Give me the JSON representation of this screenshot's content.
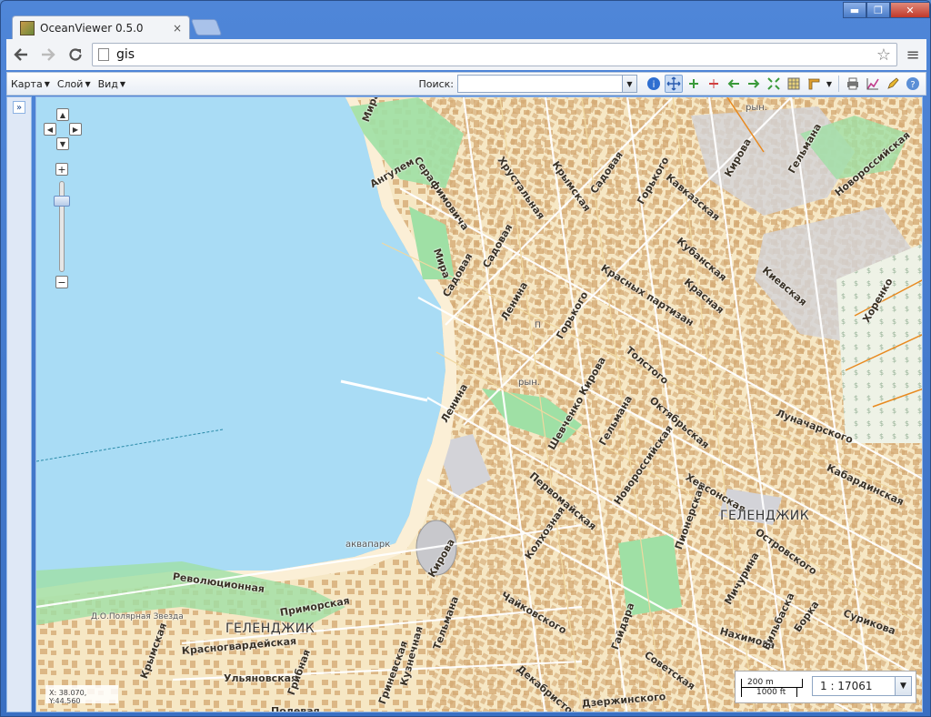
{
  "browser": {
    "tab_title": "OceanViewer 0.5.0",
    "tab_close": "×",
    "url": "gis",
    "window_minimize": "▬",
    "window_maximize": "❐",
    "window_close": "✕"
  },
  "toolbar": {
    "menus": [
      {
        "label": "Карта"
      },
      {
        "label": "Слой"
      },
      {
        "label": "Вид"
      }
    ],
    "search_label": "Поиск:",
    "search_value": ""
  },
  "icons": {
    "back": "back-arrow-icon",
    "forward": "forward-arrow-icon",
    "reload": "reload-icon",
    "star": "bookmark-star-icon",
    "menu": "hamburger-menu-icon"
  },
  "colors": {
    "water": "#a9dcf5",
    "land": "#f6e7c4",
    "park": "#9fe0a5",
    "building": "#d7ae7a",
    "industrial": "#d3d3d8"
  },
  "map": {
    "labels": {
      "street_mira_1": "Мира",
      "street_angulem": "Ангулем",
      "street_serafimovicha": "Серафимовича",
      "street_khrustalnaya": "Хрустальная",
      "street_krymskaya_1": "Крымская",
      "street_sadovaya_1": "Садовая",
      "street_gorkogo_1": "Горького",
      "street_kavkazskaya": "Кавказская",
      "street_kirova_1": "Кирова",
      "street_gelmana_1": "Гельмана",
      "street_novorossiyskaya_1": "Новороссийская",
      "street_mira_2": "Мира",
      "street_sadovaya_2": "Садовая",
      "street_sadovaya_3": "Садовая",
      "street_lenina_1": "Ленина",
      "street_gorkogo_2": "Горького",
      "street_krasnykh_partizan": "Красных партизан",
      "street_krasnaya": "Красная",
      "street_kubanskaya": "Кубанская",
      "street_kievskaya": "Киевская",
      "street_khorenko": "Хоренко",
      "street_tolstogo": "Толстого",
      "street_kirova_2": "Кирова",
      "street_oktyabrskaya": "Октябрьская",
      "street_lunacharskogo": "Луначарского",
      "street_lenina_2": "Ленина",
      "street_shevchenko": "Шевченко",
      "street_gelmana_2": "Гельмана",
      "street_pervomayskaya": "Первомайская",
      "street_novorossiyskaya_2": "Новороссийская",
      "street_khersonskaya": "Херсонская",
      "street_kabardinskaya": "Кабардинская",
      "street_pionerskaya": "Пионерская",
      "street_ostrovskogo": "Островского",
      "street_kolkhoznaya": "Колхозная",
      "street_kirova_3": "Кирова",
      "street_revolyutsionnaya": "Революционная",
      "street_primorskaya": "Приморская",
      "street_krasnogvardeyskaya": "Красногвардейская",
      "street_krymskaya_2": "Крымская",
      "street_gribnaya": "Грибная",
      "street_ulyanovskaya": "Ульяновская",
      "street_kuzhayalova": "Кузнечная",
      "street_tel_mana": "Тельмана",
      "street_chaykovskogo": "Чайковского",
      "street_dekabristov": "Декабристов",
      "street_gaydara": "Гайдара",
      "street_sovetskaya": "Советская",
      "street_dzerzhinskogo": "Дзержинского",
      "street_nakhimova": "Нахимова",
      "street_michurina": "Мичурина",
      "street_vilbaska": "Вильбаска",
      "street_borka": "Борка",
      "street_surikova": "Сурикова",
      "street_poleviya": "Полевая",
      "street_grinevskaya": "Гриневская",
      "city_1": "ГЕЛЕНДЖИК",
      "city_2": "ГЕЛЕНДЖИК",
      "poi_aquapark": "аквапарк",
      "poi_market_1": "рын.",
      "poi_market_2": "рын.",
      "poi_polar_star": "Д.О.Полярная Звезда",
      "poi_p": "П"
    },
    "coords": "X: 38.070, Y:44.560",
    "scale_m": "200 m",
    "scale_ft": "1000 ft",
    "scale_ratio": "1 : 17061"
  }
}
